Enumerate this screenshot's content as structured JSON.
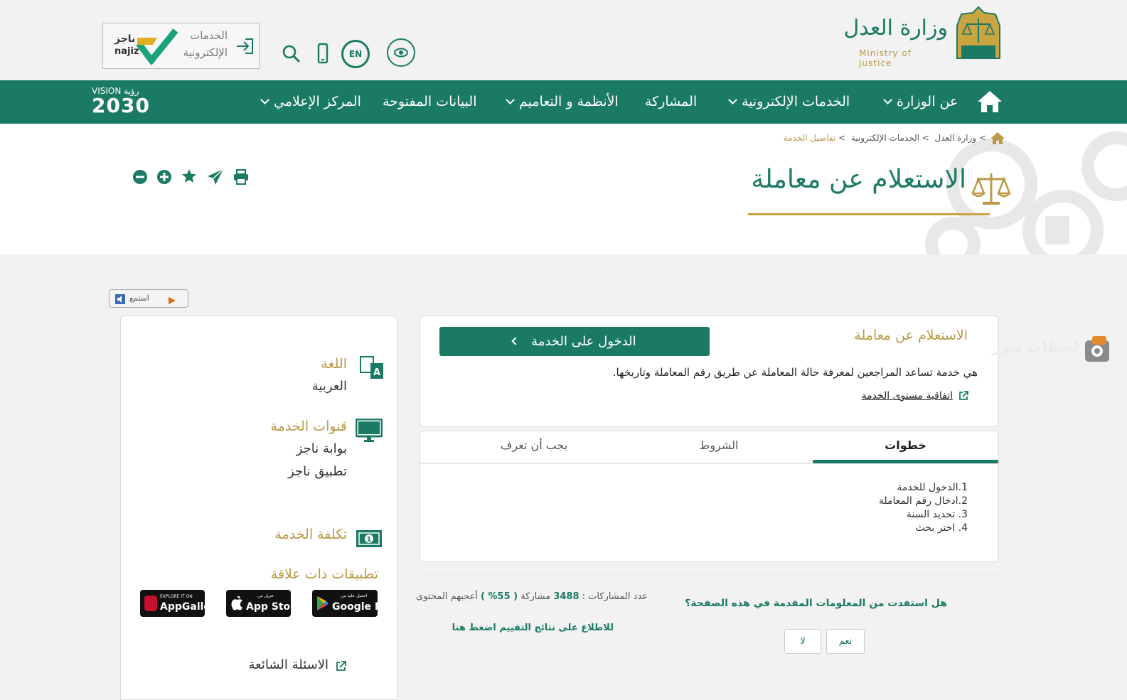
{
  "header": {
    "logo_ar": "وزارة العدل",
    "logo_en": "Ministry of Justice",
    "eservices_label_line1": "الخدمات",
    "eservices_label_line2": "الإلكترونية",
    "najiz_ar": "ناجز",
    "najiz_en": "najiz",
    "lang_toggle": "EN",
    "vision_top": "VISION رؤية",
    "vision_year": "2030"
  },
  "nav": {
    "home_icon": "home-icon",
    "items": [
      {
        "label": "عن الوزارة",
        "has_dropdown": true
      },
      {
        "label": "الخدمات الإلكترونية",
        "has_dropdown": true
      },
      {
        "label": "المشاركة",
        "has_dropdown": false
      },
      {
        "label": "الأنظمة و التعاميم",
        "has_dropdown": true
      },
      {
        "label": "البيانات المفتوحة",
        "has_dropdown": false
      },
      {
        "label": "المركز الإعلامي",
        "has_dropdown": true
      }
    ]
  },
  "breadcrumb": {
    "items": [
      "وزارة العدل",
      "الخدمات الإلكترونية",
      "تفاصيل الخدمة"
    ],
    "separator": ">"
  },
  "page": {
    "title": "الاستعلام عن معاملة",
    "listen_label": "استمع"
  },
  "service": {
    "name": "الاستعلام عن معاملة",
    "enter_button": "الدخول على الخدمة",
    "description": "هي خدمة تساعد المراجعين لمعرفة حالة المعاملة عن طريق رقم المعاملة وتاريخها.",
    "sla_link": "اتفاقية مستوى الخدمة"
  },
  "tabs": {
    "items": [
      "خطوات",
      "الشروط",
      "يجب أن تعرف"
    ],
    "active_index": 0,
    "steps": [
      "1.الدخول للخدمة",
      "2.ادخال رقم المعاملة",
      "3. تحديد السنة",
      "4. اختر بحث"
    ]
  },
  "feedback": {
    "question": "هل استفدت من المعلومات المقدمة في هذه الصفحة؟",
    "yes": "نعم",
    "no": "لا",
    "participants_prefix": "عدد المشاركات :",
    "participants_count": "3488",
    "participants_word": "مشاركة",
    "liked_percent": "( 55% )",
    "liked_suffix": "أعجبهم المحتوى",
    "results_link": "للاطلاع على نتائج التقييم اضغط هنا"
  },
  "sidebar": {
    "language_label": "اللغة",
    "language_value": "العربية",
    "channels_label": "قنوات الخدمة",
    "channels": [
      "بوابة ناجز",
      "تطبيق ناجز"
    ],
    "cost_label": "تكلفة الخدمة",
    "apps_label": "تطبيقات ذات علاقة",
    "apps": [
      {
        "small": "احصل عليه من",
        "big": "Google Play"
      },
      {
        "small": "تنزيل من",
        "big": "App Store"
      },
      {
        "small": "EXPLORE IT ON",
        "big": "AppGallery"
      }
    ],
    "faq_link": "الاسئلة الشائعة"
  },
  "watermark": "لحظات نيوز",
  "colors": {
    "primary": "#1b7a63",
    "gold": "#b99a45",
    "background": "#f2f2f2"
  }
}
